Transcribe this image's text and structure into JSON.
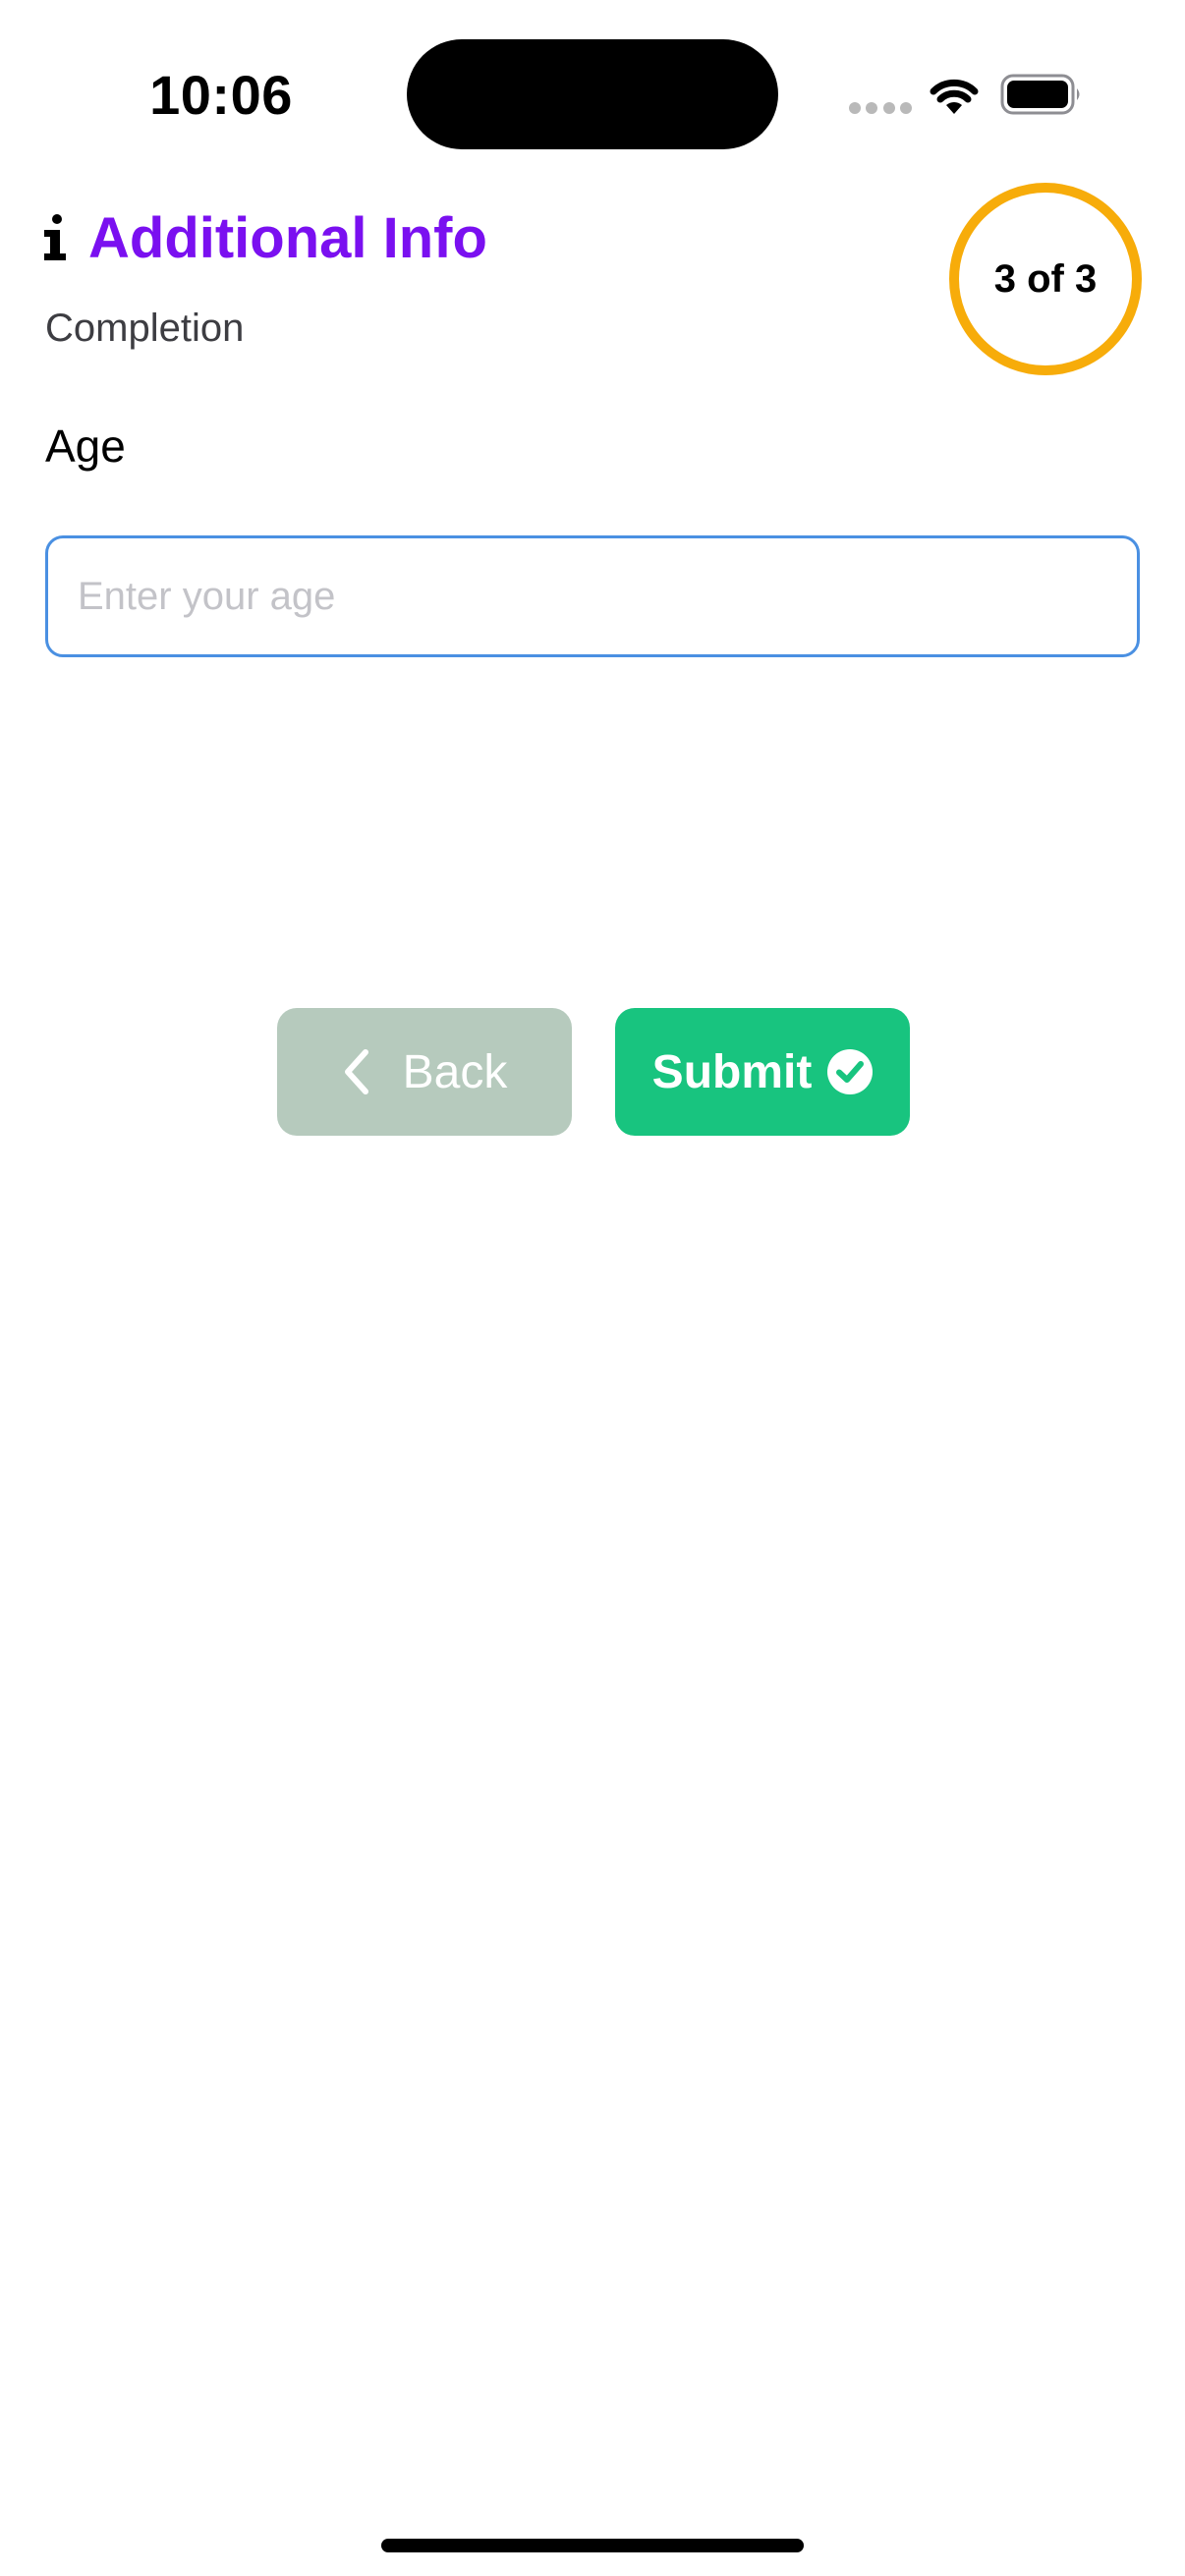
{
  "status_bar": {
    "time": "10:06"
  },
  "header": {
    "icon": "info-icon",
    "title": "Additional Info",
    "subtitle": "Completion",
    "step_badge": "3 of 3"
  },
  "form": {
    "age_label": "Age",
    "age_placeholder": "Enter your age",
    "age_value": ""
  },
  "buttons": {
    "back_label": "Back",
    "submit_label": "Submit"
  },
  "colors": {
    "title": "#7a10f0",
    "badge_ring": "#f7ac0a",
    "input_border": "#4a90e2",
    "back_button": "#b6cabd",
    "submit_button": "#18c47f"
  }
}
